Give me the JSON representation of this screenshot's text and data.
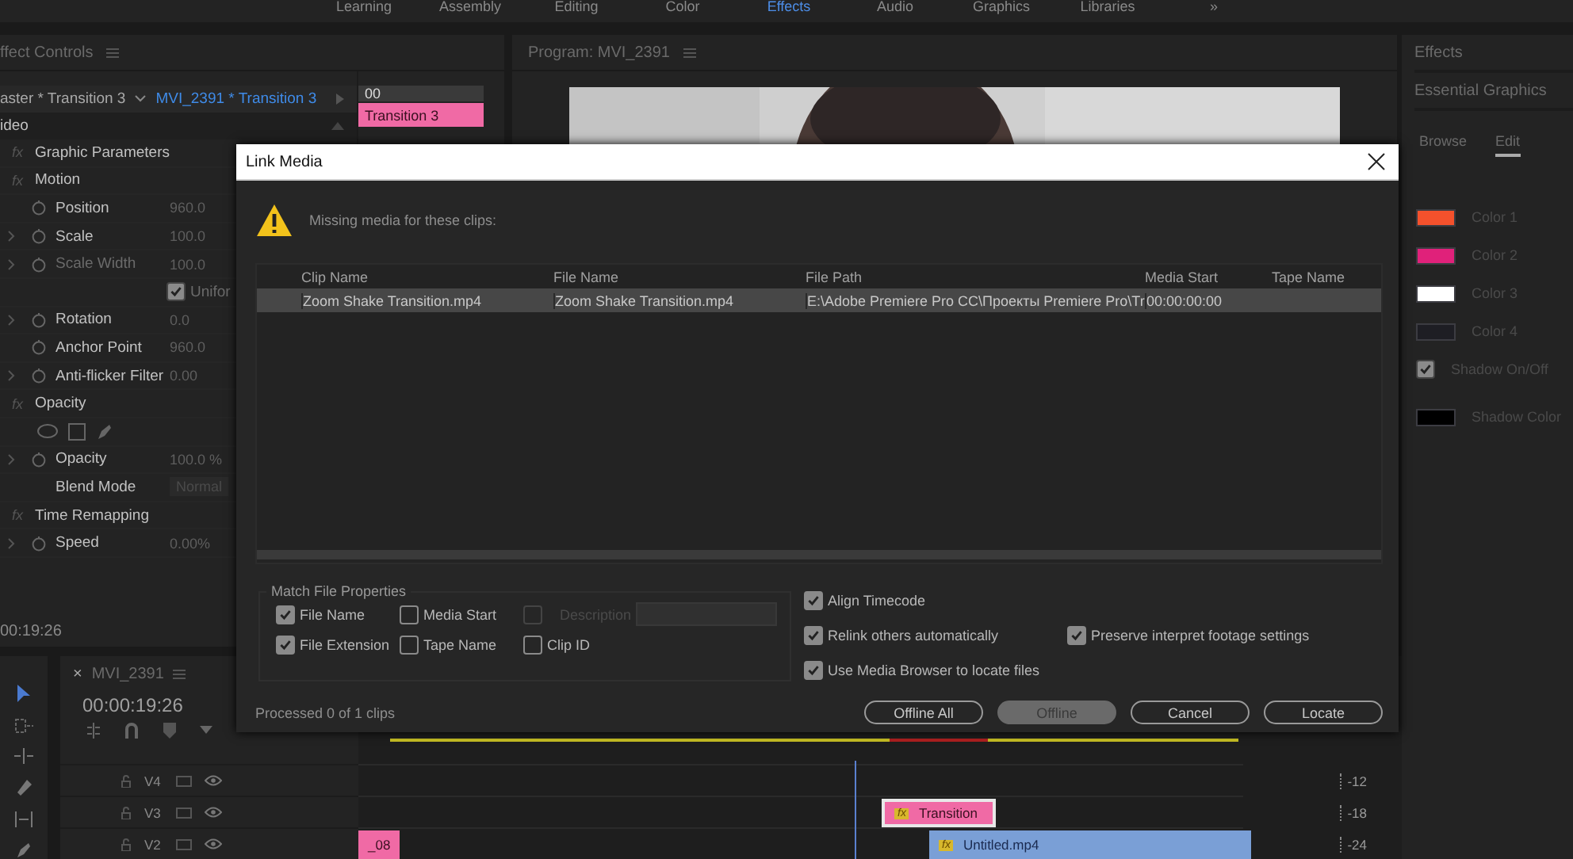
{
  "workspaces": {
    "tabs": [
      {
        "label": "Learning",
        "selected": false
      },
      {
        "label": "Assembly",
        "selected": false
      },
      {
        "label": "Editing",
        "selected": false
      },
      {
        "label": "Color",
        "selected": false
      },
      {
        "label": "Effects",
        "selected": true
      },
      {
        "label": "Audio",
        "selected": false
      },
      {
        "label": "Graphics",
        "selected": false
      },
      {
        "label": "Libraries",
        "selected": false
      }
    ],
    "overflow": "»"
  },
  "effect_controls": {
    "title": "ffect Controls",
    "master_clip": "aster * Transition 3",
    "sequence_clip": "MVI_2391 * Transition 3",
    "ruler_time": "00",
    "clip_label": "Transition 3",
    "section": "ideo",
    "rows": [
      {
        "kind": "effect",
        "badge": "fx",
        "label": "Graphic Parameters"
      },
      {
        "kind": "effect",
        "badge": "fx",
        "label": "Motion"
      },
      {
        "kind": "property",
        "label": "Position",
        "value": "960.0",
        "expandable": false,
        "disabled": false
      },
      {
        "kind": "property",
        "label": "Scale",
        "value": "100.0",
        "expandable": true,
        "disabled": false
      },
      {
        "kind": "property",
        "label": "Scale Width",
        "value": "100.0",
        "expandable": true,
        "disabled": true
      },
      {
        "kind": "checkbox",
        "label": "Unifor",
        "checked": true
      },
      {
        "kind": "property",
        "label": "Rotation",
        "value": "0.0",
        "expandable": true,
        "disabled": false
      },
      {
        "kind": "property",
        "label": "Anchor Point",
        "value": "960.0",
        "expandable": false,
        "disabled": false
      },
      {
        "kind": "property",
        "label": "Anti-flicker Filter",
        "value": "0.00",
        "expandable": true,
        "disabled": false
      },
      {
        "kind": "effect",
        "badge": "fx",
        "label": "Opacity"
      },
      {
        "kind": "masks"
      },
      {
        "kind": "property",
        "label": "Opacity",
        "value": "100.0 %",
        "expandable": true,
        "disabled": false
      },
      {
        "kind": "dropdown",
        "label": "Blend Mode",
        "value": "Normal"
      },
      {
        "kind": "effect",
        "badge": "fx",
        "label": "Time Remapping"
      },
      {
        "kind": "property",
        "label": "Speed",
        "value": "0.00%",
        "expandable": true,
        "disabled": false
      }
    ],
    "timecode": "00:19:26"
  },
  "program_monitor": {
    "title": "Program: MVI_2391"
  },
  "right_panel": {
    "effects_title": "Effects",
    "graphics_title": "Essential Graphics",
    "tabs": [
      {
        "label": "Browse",
        "selected": false
      },
      {
        "label": "Edit",
        "selected": true
      }
    ],
    "items": [
      {
        "kind": "swatch",
        "label": "Color 1",
        "color": "#f4512c"
      },
      {
        "kind": "swatch",
        "label": "Color 2",
        "color": "#e0217a"
      },
      {
        "kind": "swatch",
        "label": "Color 3",
        "color": "#ffffff"
      },
      {
        "kind": "swatch",
        "label": "Color 4",
        "color": "#1e1e24"
      },
      {
        "kind": "checkbox",
        "label": "Shadow On/Off",
        "checked": true
      },
      {
        "kind": "swatch",
        "label": "Shadow Color",
        "color": "#000000"
      }
    ]
  },
  "timeline": {
    "sequence": "MVI_2391",
    "close": "×",
    "timecode": "00:00:19:26",
    "tracks": [
      {
        "label": "V4"
      },
      {
        "label": "V3",
        "clips": [
          {
            "label": "Transition",
            "badge": "fx",
            "kind": "transition"
          }
        ]
      },
      {
        "label": "V2",
        "clips": [
          {
            "label": "_08",
            "kind": "pink"
          },
          {
            "label": "Untitled.mp4",
            "badge": "fx",
            "kind": "video"
          }
        ]
      }
    ],
    "meter_ticks": [
      "-12",
      "-18",
      "-24"
    ]
  },
  "dialog": {
    "title": "Link Media",
    "message": "Missing media for these clips:",
    "columns": [
      "Clip Name",
      "File Name",
      "File Path",
      "Media Start",
      "Tape Name"
    ],
    "rows": [
      {
        "selected": true,
        "clip_name": "Zoom Shake Transition.mp4",
        "file_name": "Zoom Shake Transition.mp4",
        "file_path": "E:\\Adobe Premiere Pro CC\\Проекты Premiere Pro\\Tr",
        "media_start": "00:00:00:00"
      }
    ],
    "match_title": "Match File Properties",
    "match_options": [
      {
        "label": "File Name",
        "checked": true,
        "disabled": false
      },
      {
        "label": "Media Start",
        "checked": false,
        "disabled": false
      },
      {
        "label": "Description",
        "checked": false,
        "disabled": true
      },
      {
        "label": "File Extension",
        "checked": true,
        "disabled": false
      },
      {
        "label": "Tape Name",
        "checked": false,
        "disabled": false
      },
      {
        "label": "Clip ID",
        "checked": false,
        "disabled": false
      }
    ],
    "options": [
      {
        "label": "Align Timecode",
        "checked": true
      },
      {
        "label": "Relink others automatically",
        "checked": true
      },
      {
        "label": "Preserve interpret footage settings",
        "checked": true
      },
      {
        "label": "Use Media Browser to locate files",
        "checked": true
      }
    ],
    "status": "Processed 0 of 1 clips",
    "buttons": [
      {
        "label": "Offline All",
        "highlighted": false
      },
      {
        "label": "Offline",
        "highlighted": true
      },
      {
        "label": "Cancel",
        "highlighted": false
      },
      {
        "label": "Locate",
        "highlighted": false
      }
    ]
  }
}
